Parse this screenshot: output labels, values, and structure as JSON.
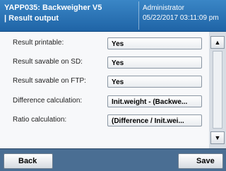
{
  "header": {
    "title": "YAPP035: Backweigher V5",
    "subtitle": "| Result output",
    "user": "Administrator",
    "datetime": "05/22/2017 03:11:09 pm"
  },
  "rows": [
    {
      "label": "Result printable:",
      "value": "Yes"
    },
    {
      "label": "Result savable on SD:",
      "value": "Yes"
    },
    {
      "label": "Result savable on FTP:",
      "value": "Yes"
    },
    {
      "label": "Difference calculation:",
      "value": "Init.weight - (Backwe..."
    },
    {
      "label": "Ratio calculation:",
      "value": "(Difference / Init.wei..."
    }
  ],
  "scrollbar": {
    "up_icon": "▲",
    "down_icon": "▼"
  },
  "footer": {
    "back_label": "Back",
    "save_label": "Save"
  },
  "colors": {
    "header_top": "#3a86c6",
    "header_bottom": "#1f64a6",
    "footer": "#4a6e93"
  }
}
